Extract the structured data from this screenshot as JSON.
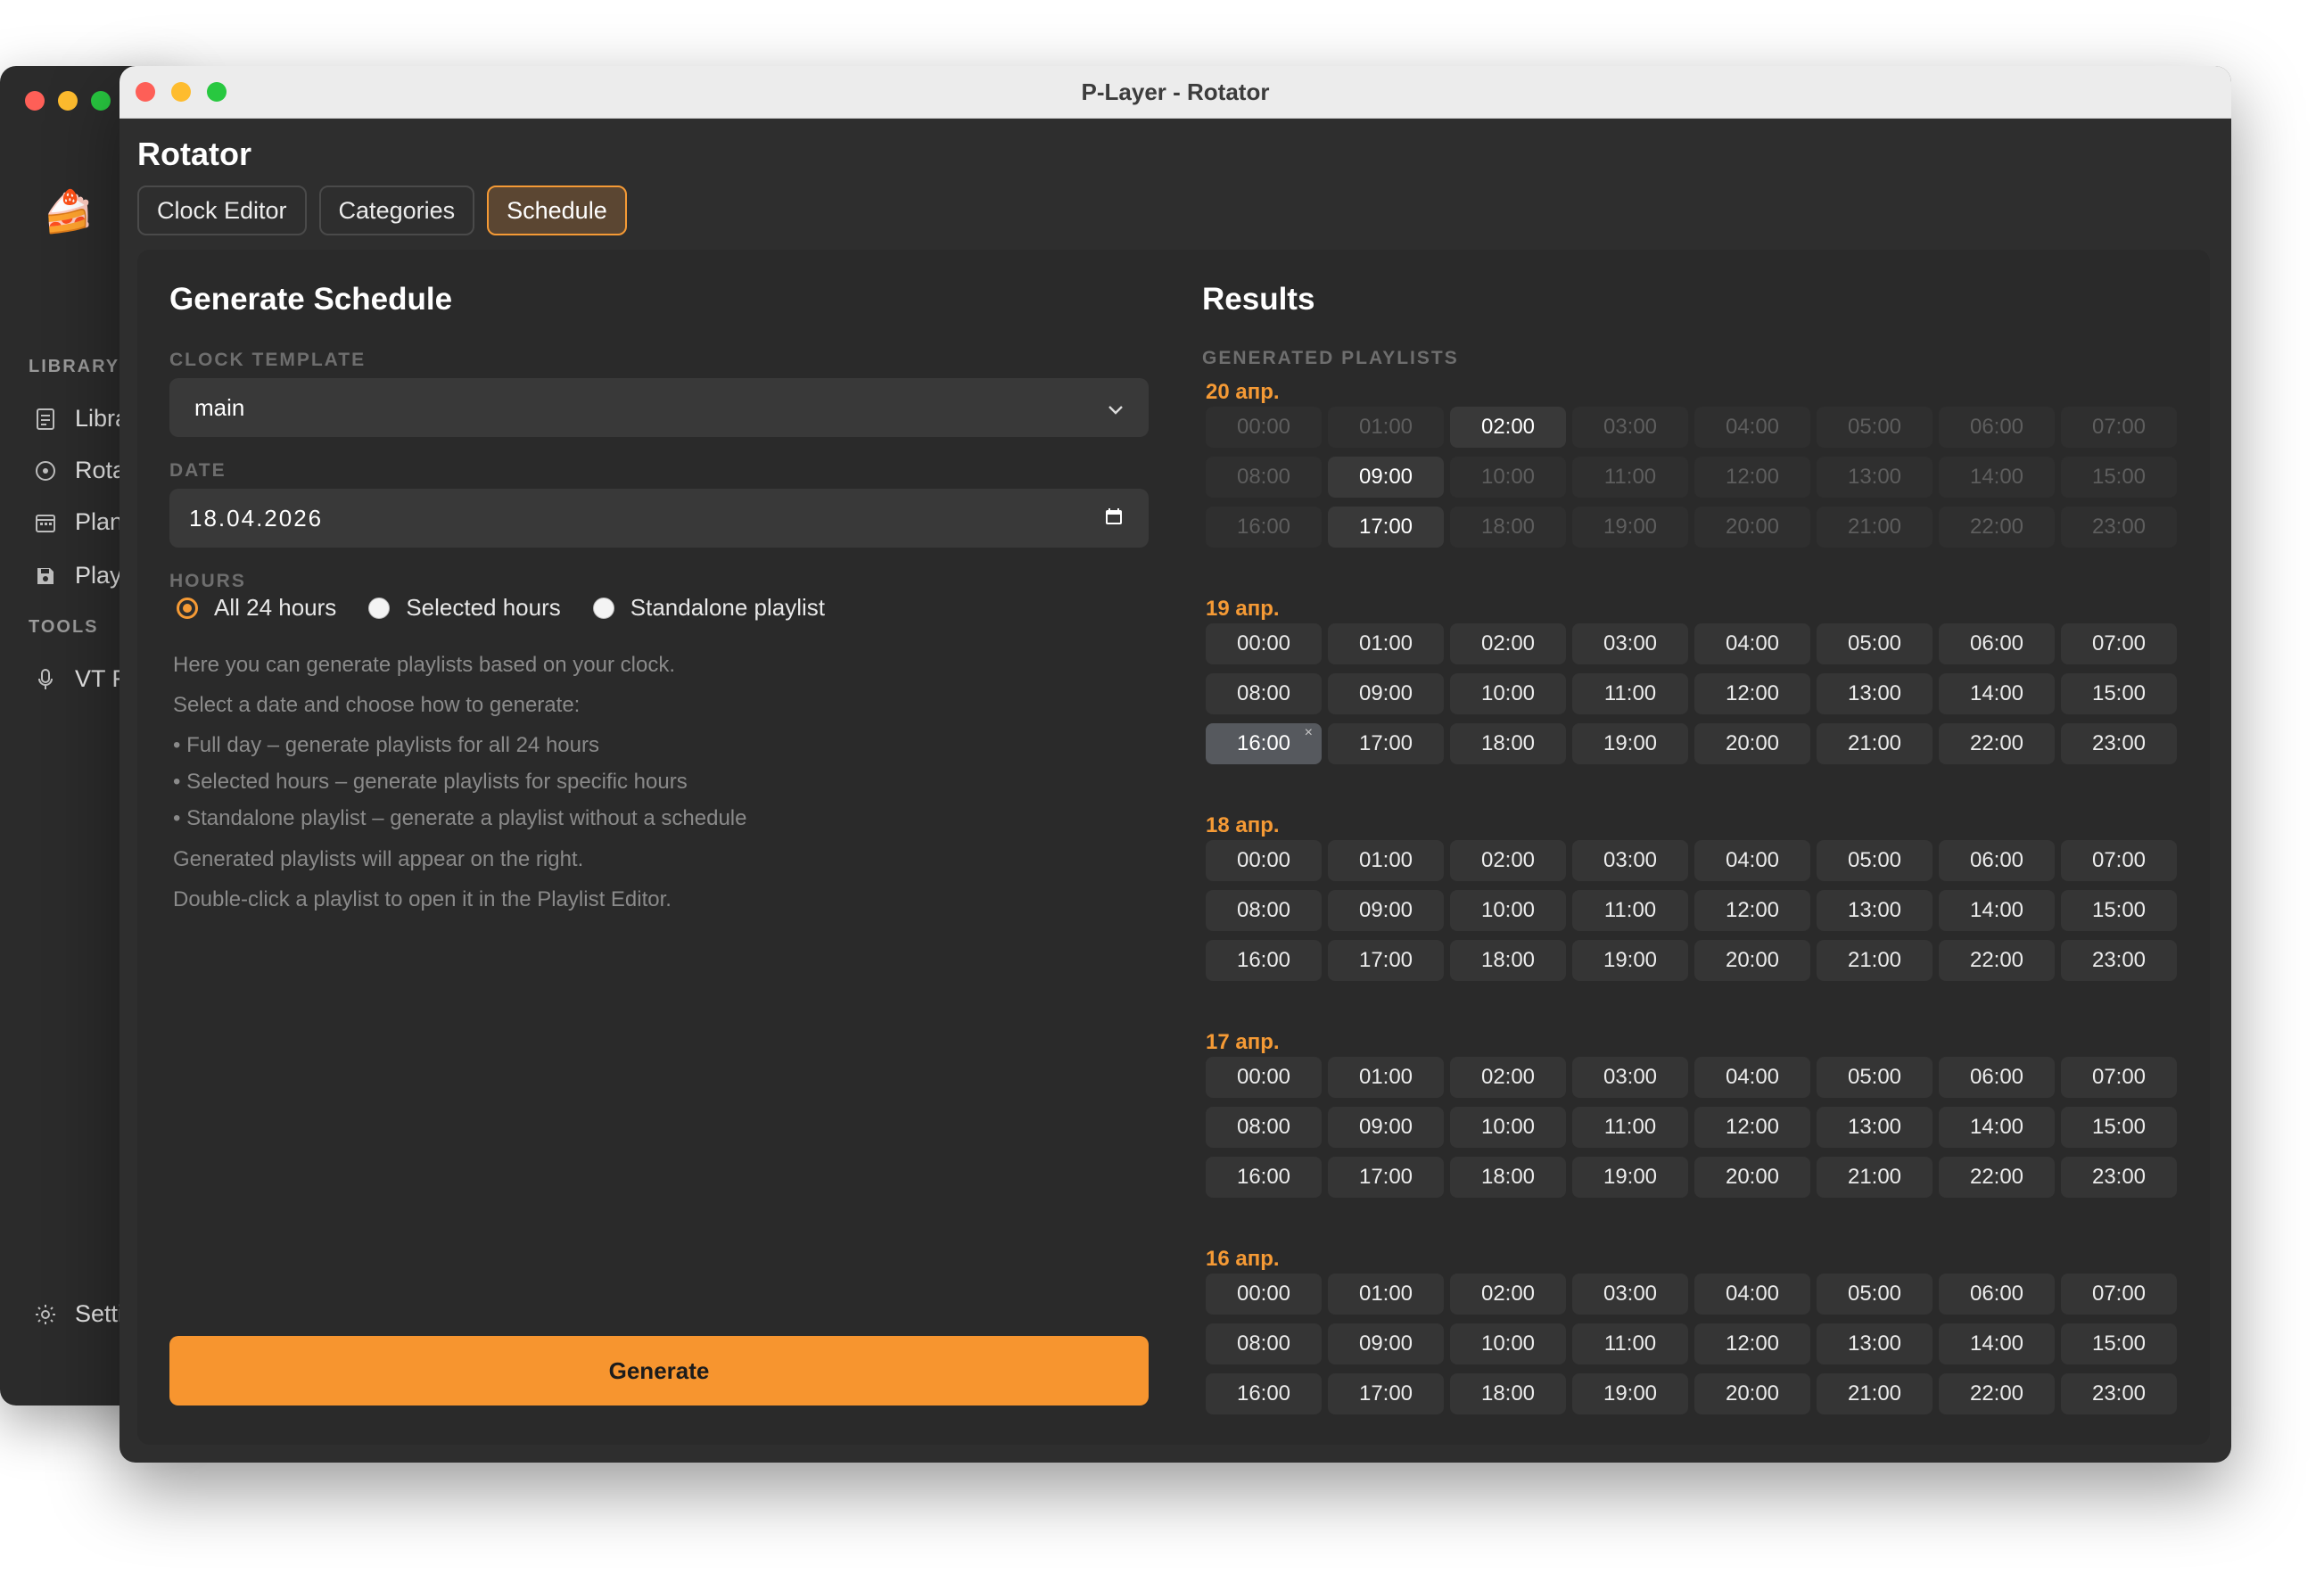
{
  "background_app": {
    "sections": [
      {
        "label": "LIBRARY",
        "items": [
          {
            "label": "Libra",
            "icon": "document-icon"
          },
          {
            "label": "Rota",
            "icon": "disc-icon"
          },
          {
            "label": "Plan",
            "icon": "calendar-icon"
          },
          {
            "label": "Play",
            "icon": "save-icon"
          }
        ]
      },
      {
        "label": "TOOLS",
        "items": [
          {
            "label": "VT F",
            "icon": "microphone-icon"
          }
        ]
      }
    ],
    "footer_item": {
      "label": "Setti",
      "icon": "sun-icon"
    }
  },
  "window": {
    "title": "P-Layer - Rotator"
  },
  "app_title": "Rotator",
  "tabs": [
    {
      "label": "Clock Editor",
      "active": false
    },
    {
      "label": "Categories",
      "active": false
    },
    {
      "label": "Schedule",
      "active": true
    }
  ],
  "generate_panel": {
    "title": "Generate Schedule",
    "clock_template_label": "CLOCK TEMPLATE",
    "clock_template_value": "main",
    "date_label": "DATE",
    "date_value": "18.04.2026",
    "hours_label": "HOURS",
    "hour_modes": [
      {
        "label": "All 24 hours",
        "selected": true
      },
      {
        "label": "Selected hours",
        "selected": false
      },
      {
        "label": "Standalone playlist",
        "selected": false
      }
    ],
    "help_lines": [
      "Here you can generate playlists based on your clock.",
      "Select a date and choose how to generate:",
      "• Full day – generate playlists for all 24 hours",
      "• Selected hours – generate playlists for specific hours",
      "• Standalone playlist – generate a playlist without a schedule",
      "Generated playlists will appear on the right.",
      "Double-click a playlist to open it in the Playlist Editor."
    ],
    "generate_label": "Generate"
  },
  "results": {
    "title": "Results",
    "subtitle": "GENERATED PLAYLISTS",
    "hours": [
      "00:00",
      "01:00",
      "02:00",
      "03:00",
      "04:00",
      "05:00",
      "06:00",
      "07:00",
      "08:00",
      "09:00",
      "10:00",
      "11:00",
      "12:00",
      "13:00",
      "14:00",
      "15:00",
      "16:00",
      "17:00",
      "18:00",
      "19:00",
      "20:00",
      "21:00",
      "22:00",
      "23:00"
    ],
    "days": [
      {
        "label": "20 апр.",
        "available": [
          "02:00",
          "09:00",
          "17:00"
        ],
        "selected": null
      },
      {
        "label": "19 апр.",
        "available": "all",
        "selected": "16:00"
      },
      {
        "label": "18 апр.",
        "available": "all",
        "selected": null
      },
      {
        "label": "17 апр.",
        "available": "all",
        "selected": null
      },
      {
        "label": "16 апр.",
        "available": "all",
        "selected": null
      }
    ],
    "remove_glyph": "×"
  },
  "colors": {
    "accent": "#f59a35",
    "window_bg": "#2e2e2e",
    "panel_bg": "#2a2a2a"
  }
}
